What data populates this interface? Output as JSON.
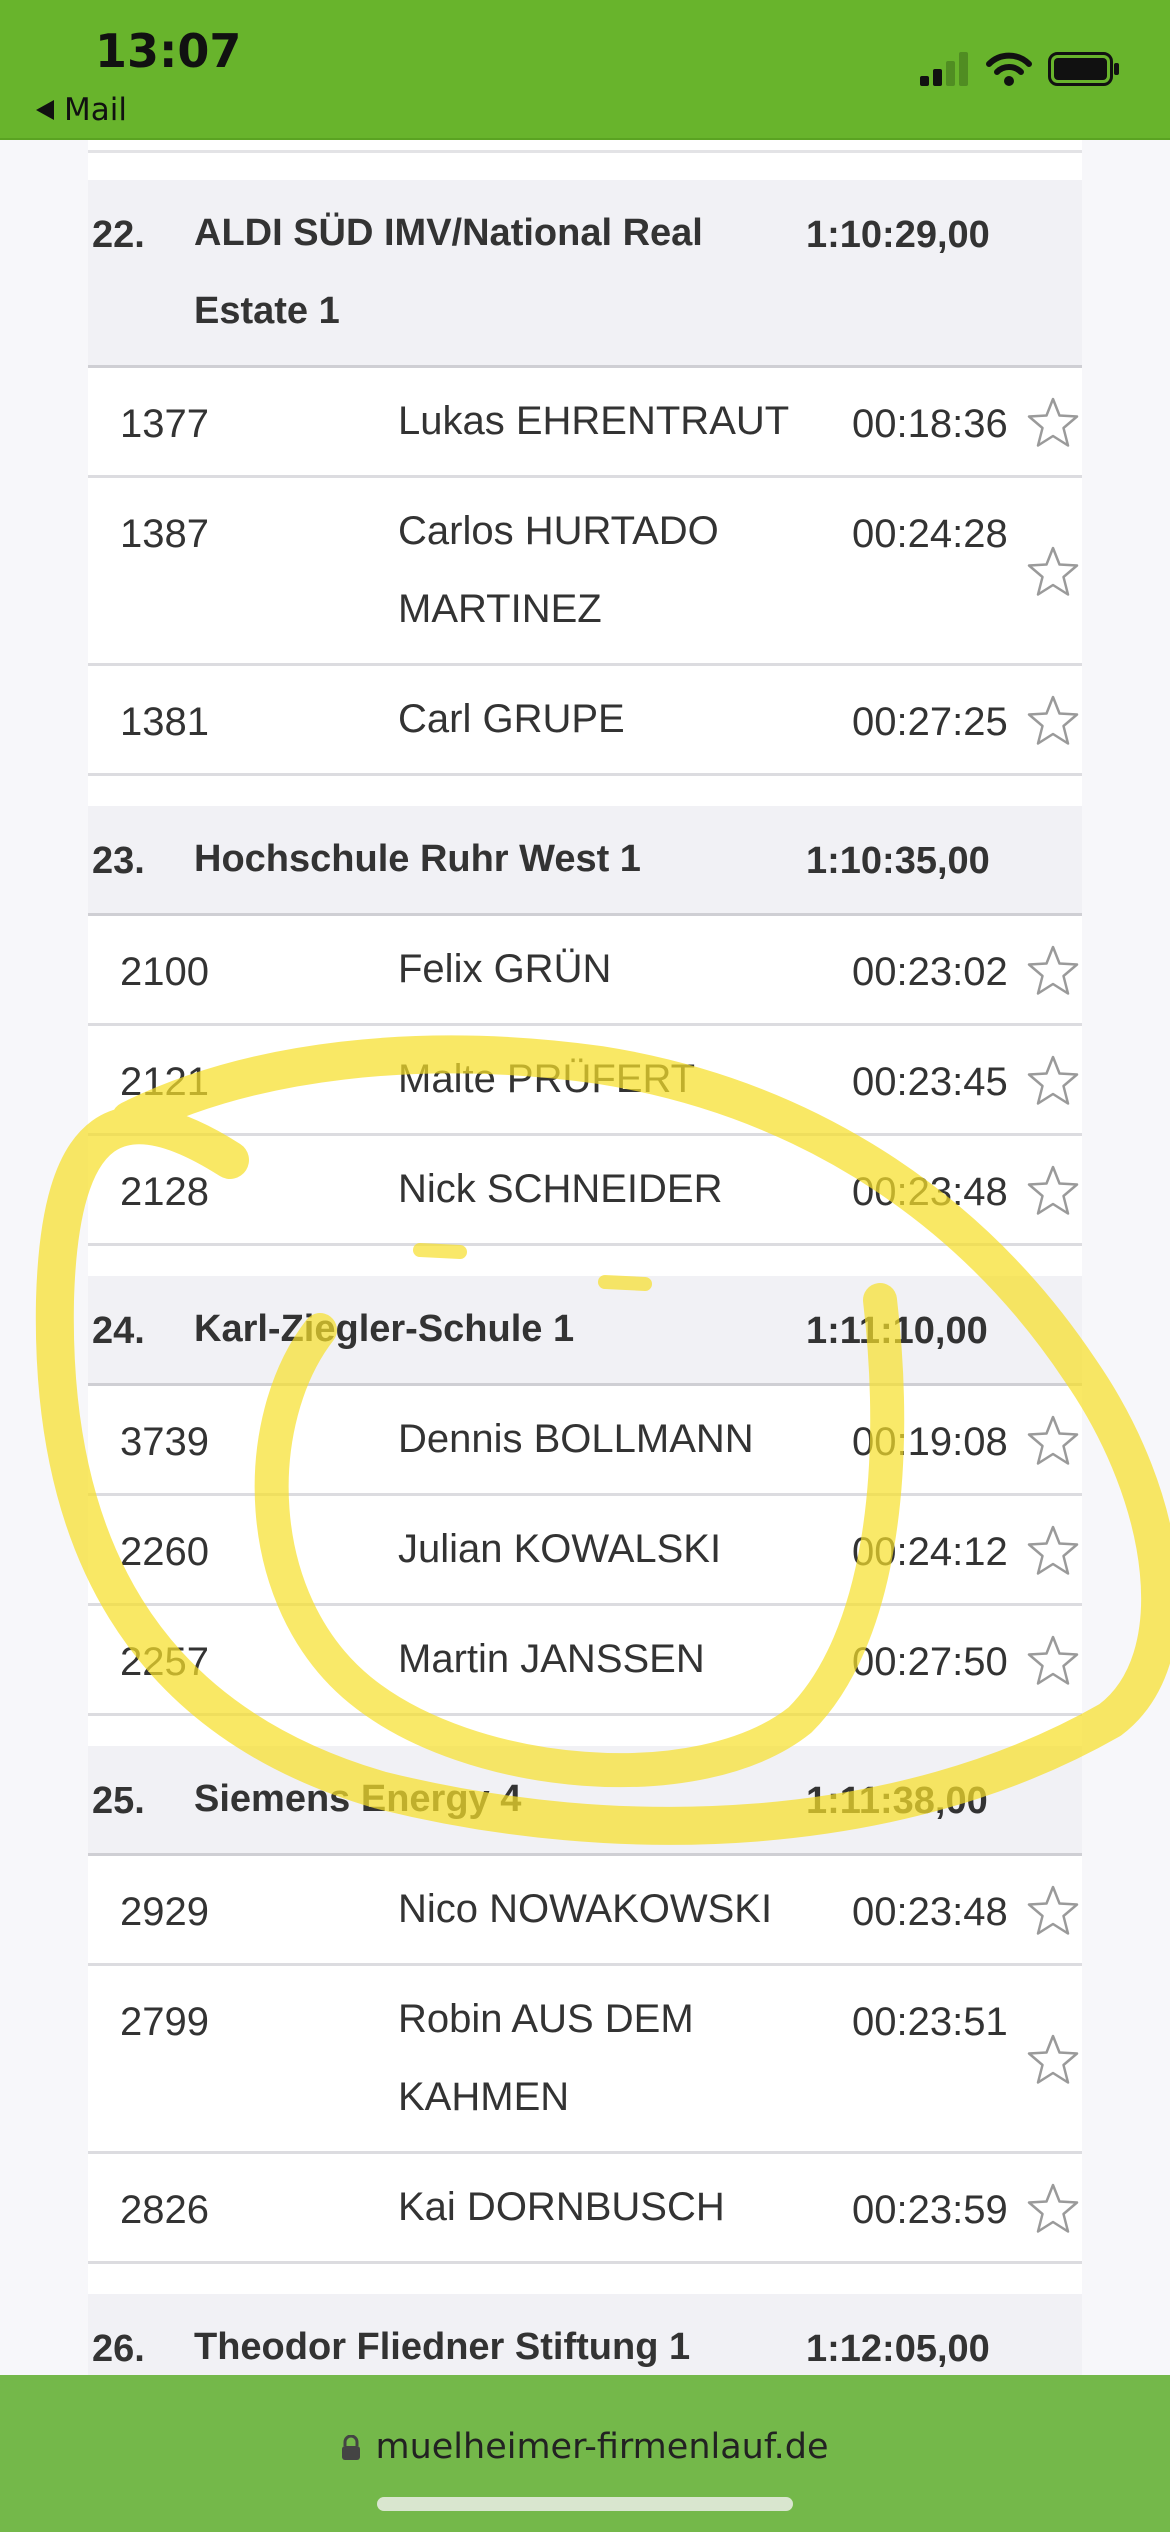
{
  "status_bar": {
    "time": "13:07",
    "back_label": "Mail",
    "signal_icon": "cellular-signal-icon",
    "wifi_icon": "wifi-icon",
    "battery_icon": "battery-icon"
  },
  "teams": [
    {
      "rank": "22.",
      "name": "ALDI SÜD IMV/National Real Estate 1",
      "time": "1:10:29,00",
      "runners": [
        {
          "bib": "1377",
          "name": "Lukas EHRENTRAUT",
          "time": "00:18:36"
        },
        {
          "bib": "1387",
          "name": "Carlos HURTADO MARTINEZ",
          "time": "00:24:28"
        },
        {
          "bib": "1381",
          "name": "Carl GRUPE",
          "time": "00:27:25"
        }
      ]
    },
    {
      "rank": "23.",
      "name": "Hochschule Ruhr West 1",
      "time": "1:10:35,00",
      "runners": [
        {
          "bib": "2100",
          "name": "Felix GRÜN",
          "time": "00:23:02"
        },
        {
          "bib": "2121",
          "name": "Malte PRÜFERT",
          "time": "00:23:45"
        },
        {
          "bib": "2128",
          "name": "Nick SCHNEIDER",
          "time": "00:23:48"
        }
      ]
    },
    {
      "rank": "24.",
      "name": "Karl-Ziegler-Schule 1",
      "time": "1:11:10,00",
      "runners": [
        {
          "bib": "3739",
          "name": "Dennis BOLLMANN",
          "time": "00:19:08"
        },
        {
          "bib": "2260",
          "name": "Julian KOWALSKI",
          "time": "00:24:12"
        },
        {
          "bib": "2257",
          "name": "Martin JANSSEN",
          "time": "00:27:50"
        }
      ]
    },
    {
      "rank": "25.",
      "name": "Siemens Energy 4",
      "time": "1:11:38,00",
      "runners": [
        {
          "bib": "2929",
          "name": "Nico NOWAKOWSKI",
          "time": "00:23:48"
        },
        {
          "bib": "2799",
          "name": "Robin AUS DEM KAHMEN",
          "time": "00:23:51"
        },
        {
          "bib": "2826",
          "name": "Kai DORNBUSCH",
          "time": "00:23:59"
        }
      ]
    },
    {
      "rank": "26.",
      "name": "Theodor Fliedner Stiftung 1",
      "time": "1:12:05,00",
      "runners": []
    }
  ],
  "url_bar": {
    "url": "muelheimer-firmenlauf.de",
    "lock_icon": "lock-icon"
  },
  "colors": {
    "brand_green": "#68b42c",
    "url_bar_green": "#74b84a",
    "header_bg": "#f1f1f5",
    "highlight_yellow": "#f7df2a"
  }
}
